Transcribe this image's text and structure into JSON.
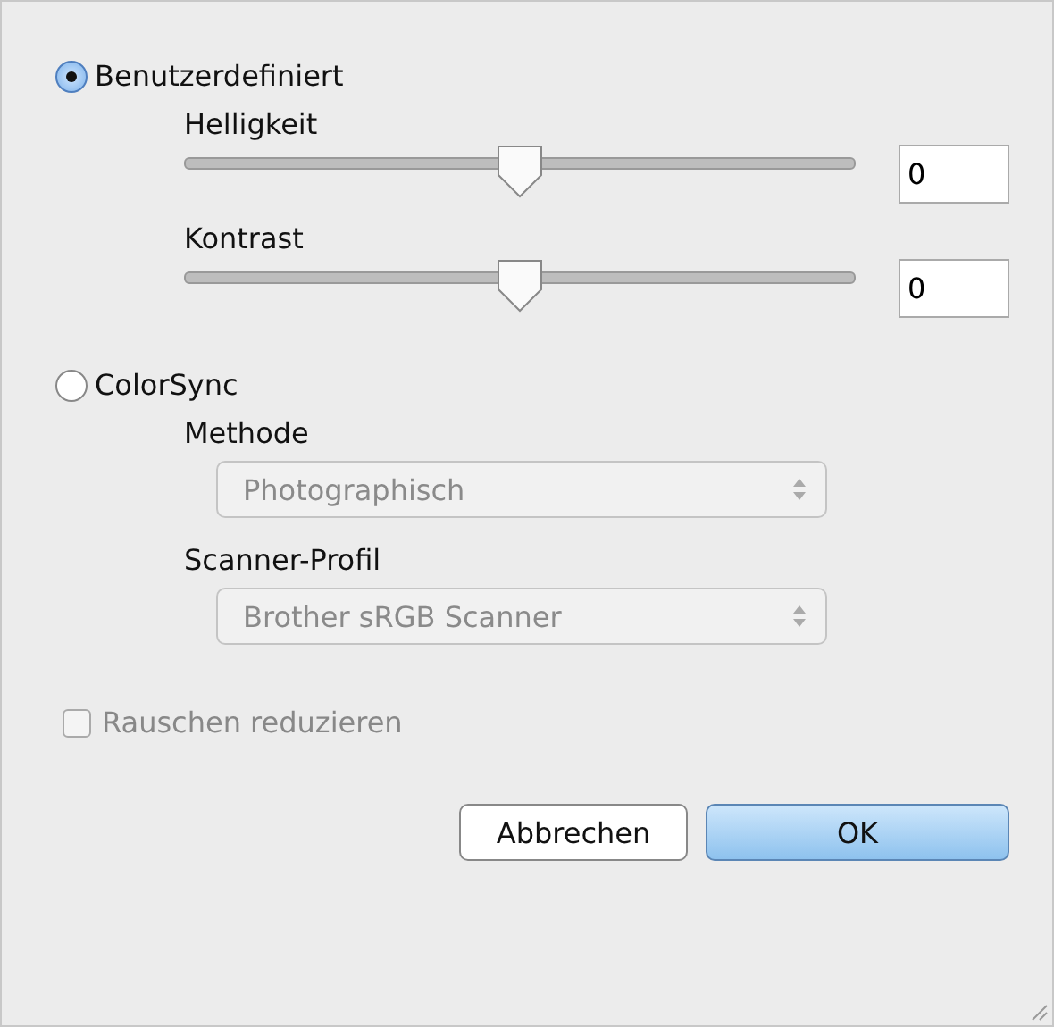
{
  "modes": [
    {
      "label": "Benutzerdefiniert",
      "selected": true
    },
    {
      "label": "ColorSync",
      "selected": false
    }
  ],
  "sliders": [
    {
      "label": "Helligkeit",
      "level": 0.5,
      "value": "0"
    },
    {
      "label": "Kontrast",
      "level": 0.5,
      "value": "0"
    }
  ],
  "popups": [
    {
      "label": "Methode",
      "value": "Photographisch",
      "disabled": true
    },
    {
      "label": "Scanner-Profil",
      "value": "Brother sRGB Scanner",
      "disabled": true
    }
  ],
  "noise": {
    "label": "Rauschen reduzieren",
    "checked": false
  },
  "buttons": [
    {
      "label": "Abbrechen",
      "default": false
    },
    {
      "label": "OK",
      "default": true
    }
  ]
}
